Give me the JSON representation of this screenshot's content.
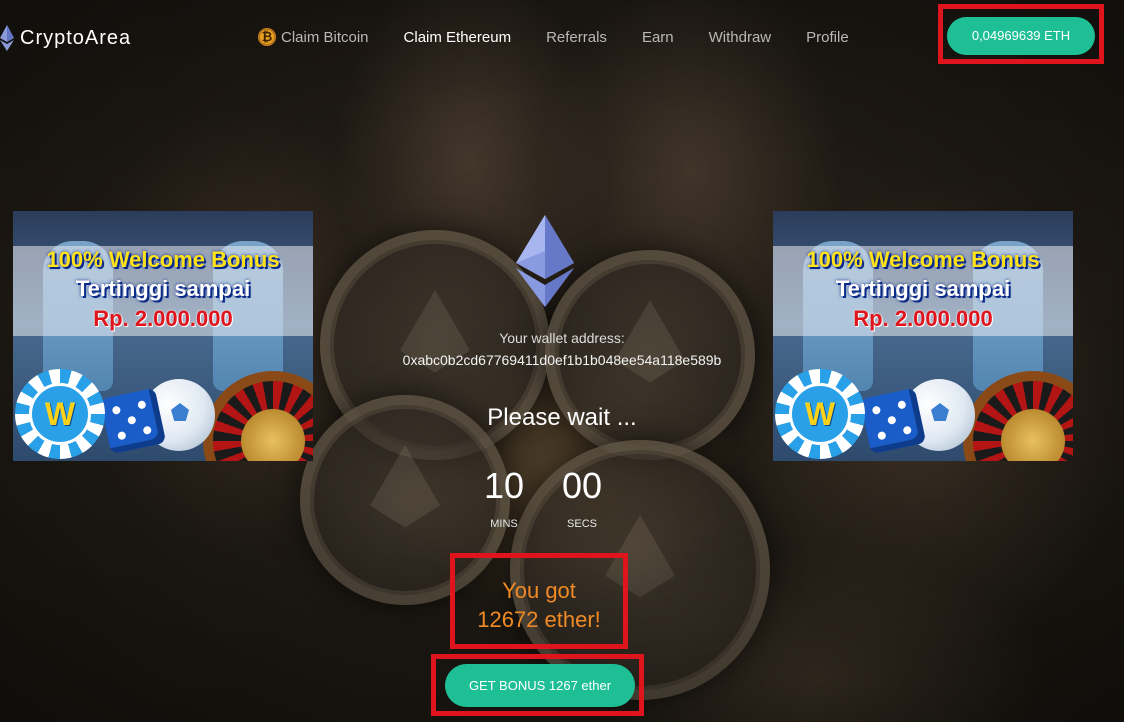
{
  "header": {
    "brand": "CryptoArea",
    "nav": [
      {
        "label": "Claim Bitcoin",
        "icon": "bitcoin-icon",
        "active": false
      },
      {
        "label": "Claim Ethereum",
        "active": true
      },
      {
        "label": "Referrals",
        "active": false
      },
      {
        "label": "Earn",
        "active": false
      },
      {
        "label": "Withdraw",
        "active": false
      },
      {
        "label": "Profile",
        "active": false
      }
    ],
    "balance": "0,04969639 ETH",
    "bitcoin_symbol": "₿"
  },
  "banner": {
    "line1": "100% Welcome Bonus",
    "line2": "Tertinggi sampai",
    "line3": "Rp. 2.000.000",
    "chip_letter": "W"
  },
  "main": {
    "wallet_label": "Your wallet address:",
    "wallet_address": "0xabc0b2cd67769411d0ef1b1b048ee54a118e589b",
    "wait_text": "Please wait ...",
    "timer": {
      "minutes": "10",
      "minutes_label": "MINS",
      "seconds": "00",
      "seconds_label": "SECS"
    },
    "reward_line1": "You got",
    "reward_line2": "12672 ether!",
    "bonus_button": "GET BONUS 1267 ether"
  },
  "colors": {
    "accent": "#1fbf96",
    "highlight_border": "#e0141c",
    "reward_text": "#f08a24"
  }
}
